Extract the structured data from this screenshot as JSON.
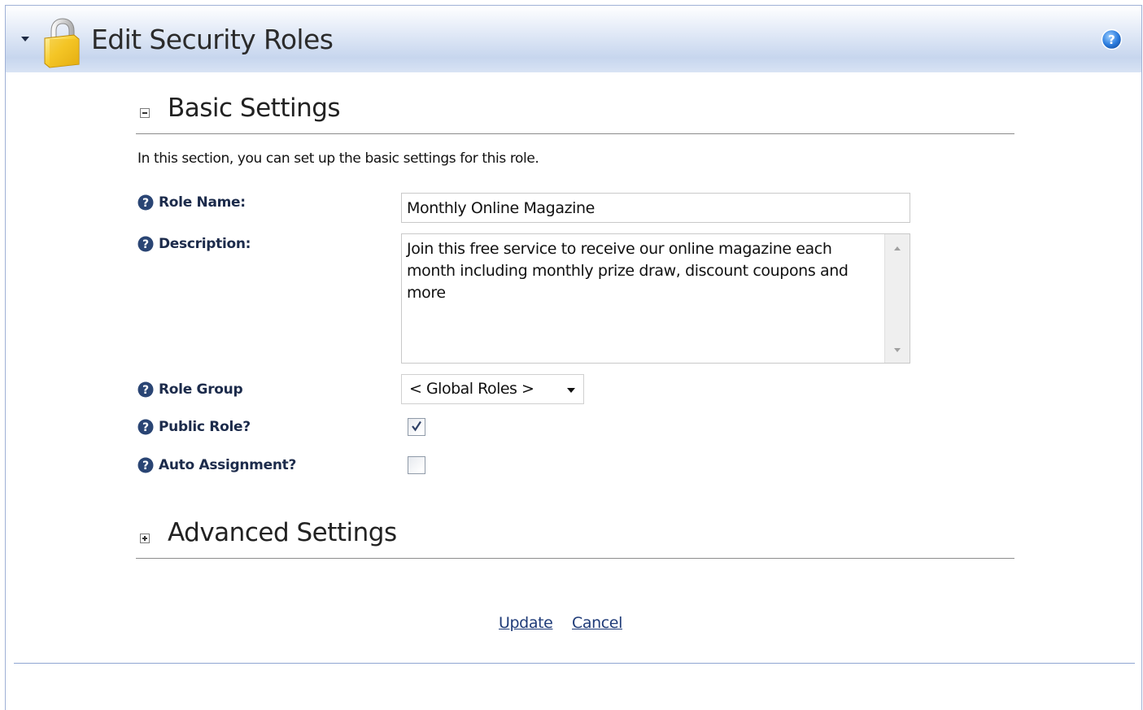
{
  "window": {
    "title": "Edit Security Roles"
  },
  "sections": {
    "basic": {
      "title": "Basic Settings",
      "intro": "In this section, you can set up the basic settings for this role."
    },
    "advanced": {
      "title": "Advanced Settings"
    }
  },
  "fields": {
    "role_name": {
      "label": "Role Name:",
      "value": "Monthly Online Magazine"
    },
    "description": {
      "label": "Description:",
      "value": "Join this free service to receive our online magazine each month including monthly prize draw, discount coupons and more"
    },
    "role_group": {
      "label": "Role Group",
      "selected": "< Global Roles >"
    },
    "public_role": {
      "label": "Public Role?",
      "checked": true
    },
    "auto_assignment": {
      "label": "Auto Assignment?",
      "checked": false
    }
  },
  "actions": {
    "update_label": "Update",
    "cancel_label": "Cancel"
  },
  "colors": {
    "label_text": "#1c2b4b",
    "link": "#1f3b78",
    "header_gradient_end": "#c7d6ee"
  }
}
